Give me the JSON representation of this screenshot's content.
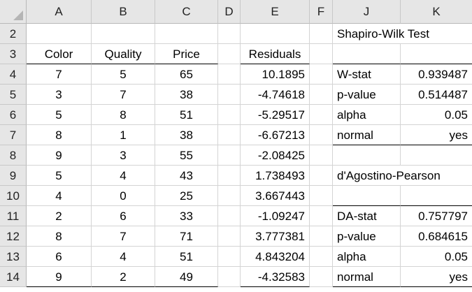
{
  "columns": [
    "A",
    "B",
    "C",
    "D",
    "E",
    "F",
    "J",
    "K"
  ],
  "rows": [
    "2",
    "3",
    "4",
    "5",
    "6",
    "7",
    "8",
    "9",
    "10",
    "11",
    "12",
    "13",
    "14"
  ],
  "headers": {
    "color": "Color",
    "quality": "Quality",
    "price": "Price",
    "residuals": "Residuals"
  },
  "data": [
    {
      "color": "7",
      "quality": "5",
      "price": "65",
      "residual": "10.1895"
    },
    {
      "color": "3",
      "quality": "7",
      "price": "38",
      "residual": "-4.74618"
    },
    {
      "color": "5",
      "quality": "8",
      "price": "51",
      "residual": "-5.29517"
    },
    {
      "color": "8",
      "quality": "1",
      "price": "38",
      "residual": "-6.67213"
    },
    {
      "color": "9",
      "quality": "3",
      "price": "55",
      "residual": "-2.08425"
    },
    {
      "color": "5",
      "quality": "4",
      "price": "43",
      "residual": "1.738493"
    },
    {
      "color": "4",
      "quality": "0",
      "price": "25",
      "residual": "3.667443"
    },
    {
      "color": "2",
      "quality": "6",
      "price": "33",
      "residual": "-1.09247"
    },
    {
      "color": "8",
      "quality": "7",
      "price": "71",
      "residual": "3.777381"
    },
    {
      "color": "6",
      "quality": "4",
      "price": "51",
      "residual": "4.843204"
    },
    {
      "color": "9",
      "quality": "2",
      "price": "49",
      "residual": "-4.32583"
    }
  ],
  "shapiro_wilk": {
    "title": "Shapiro-Wilk Test",
    "w_label": "W-stat",
    "w_value": "0.939487",
    "p_label": "p-value",
    "p_value": "0.514487",
    "alpha_label": "alpha",
    "alpha_value": "0.05",
    "normal_label": "normal",
    "normal_value": "yes"
  },
  "dagostino": {
    "title": "d'Agostino-Pearson",
    "da_label": "DA-stat",
    "da_value": "0.757797",
    "p_label": "p-value",
    "p_value": "0.684615",
    "alpha_label": "alpha",
    "alpha_value": "0.05",
    "normal_label": "normal",
    "normal_value": "yes"
  }
}
